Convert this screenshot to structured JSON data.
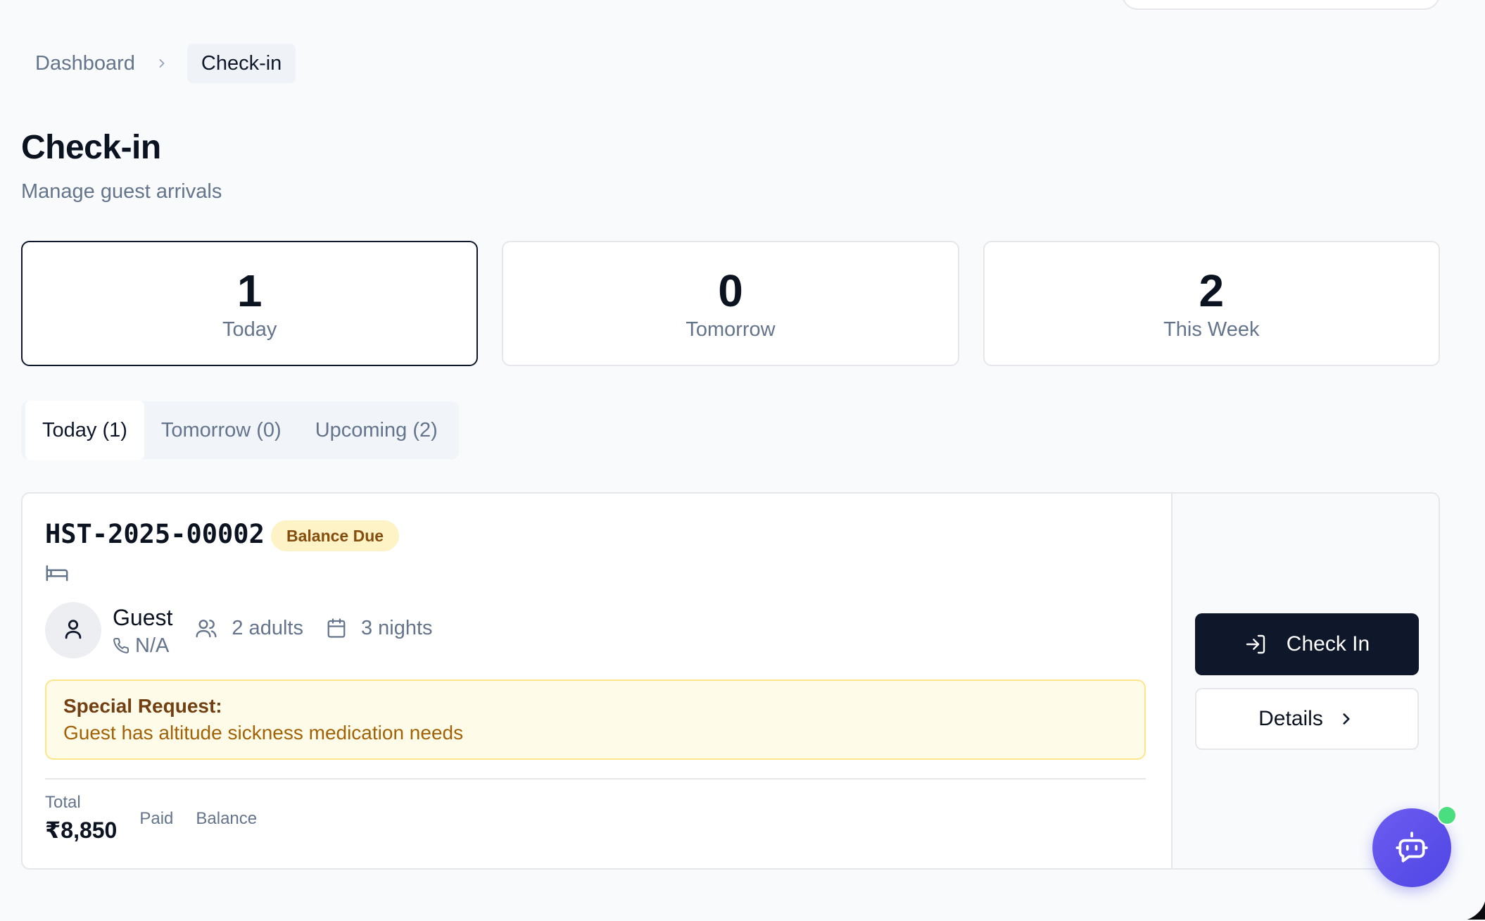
{
  "breadcrumb": {
    "parent": "Dashboard",
    "current": "Check-in"
  },
  "page": {
    "title": "Check-in",
    "subtitle": "Manage guest arrivals"
  },
  "stats": [
    {
      "value": "1",
      "label": "Today"
    },
    {
      "value": "0",
      "label": "Tomorrow"
    },
    {
      "value": "2",
      "label": "This Week"
    }
  ],
  "tabs": [
    {
      "label": "Today (1)",
      "active": true
    },
    {
      "label": "Tomorrow (0)",
      "active": false
    },
    {
      "label": "Upcoming (2)",
      "active": false
    }
  ],
  "booking": {
    "id": "HST-2025-00002",
    "badge": "Balance Due",
    "guest_name": "Guest",
    "phone": "N/A",
    "adults": "2 adults",
    "nights": "3 nights",
    "special_request_title": "Special Request:",
    "special_request_text": "Guest has altitude sickness medication needs",
    "total_label": "Total",
    "total_value": "₹8,850",
    "paid_label": "Paid",
    "balance_label": "Balance",
    "check_in_label": "Check In",
    "details_label": "Details"
  },
  "colors": {
    "primary_button": "#0f172a",
    "badge_bg": "#fef3c7",
    "special_bg": "#fefce8",
    "fab_accent": "#4f46e5",
    "online": "#4ade80"
  },
  "icons": {
    "breadcrumb_separator": "chevron-right-icon",
    "room": "bed-icon",
    "avatar": "user-icon",
    "phone": "phone-icon",
    "adults": "users-icon",
    "nights": "calendar-icon",
    "check_in": "log-in-icon",
    "details": "chevron-right-icon",
    "assistant": "bot-icon"
  }
}
